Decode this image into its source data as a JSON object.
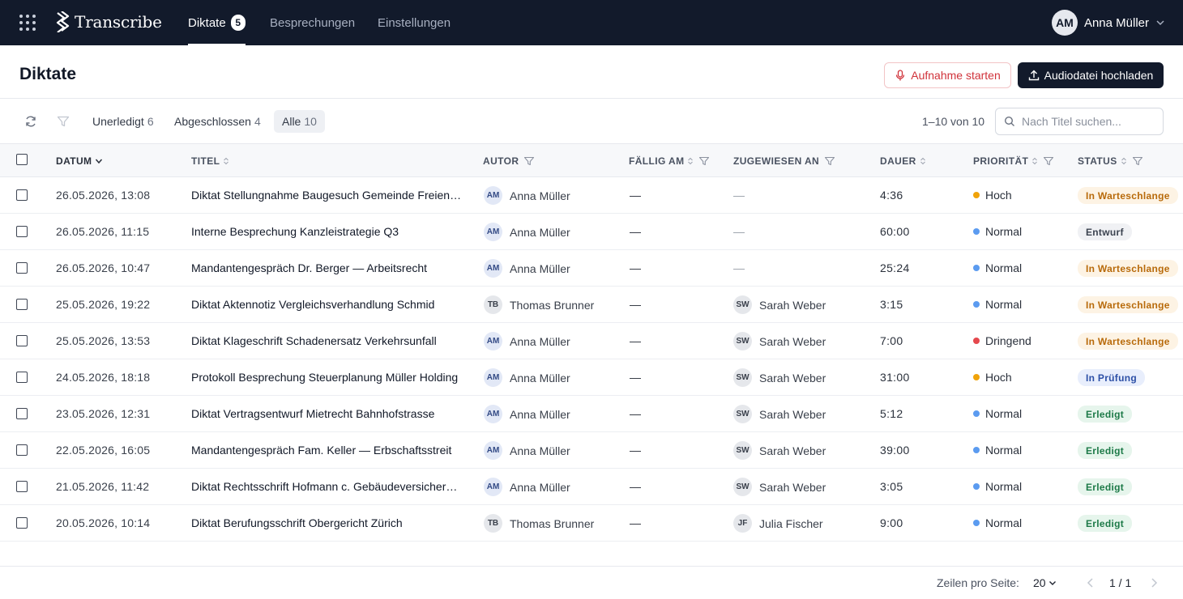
{
  "nav": {
    "brand": "Transcribe",
    "items": [
      {
        "label": "Diktate",
        "badge": "5"
      },
      {
        "label": "Besprechungen"
      },
      {
        "label": "Einstellungen"
      }
    ],
    "user": {
      "initials": "AM",
      "name": "Anna Müller"
    }
  },
  "header": {
    "title": "Diktate",
    "record_label": "Aufnahme starten",
    "upload_label": "Audiodatei hochladen"
  },
  "toolbar": {
    "tabs": [
      {
        "label": "Unerledigt",
        "count": "6"
      },
      {
        "label": "Abgeschlossen",
        "count": "4"
      },
      {
        "label": "Alle",
        "count": "10"
      }
    ],
    "range": "1–10 von 10",
    "search_placeholder": "Nach Titel suchen..."
  },
  "table": {
    "columns": [
      "DATUM",
      "TITEL",
      "AUTOR",
      "FÄLLIG AM",
      "ZUGEWIESEN AN",
      "DAUER",
      "PRIORITÄT",
      "STATUS"
    ],
    "rows": [
      {
        "date": "26.05.2026, 13:08",
        "title": "Diktat Stellungnahme Baugesuch Gemeinde Freienbach",
        "author_initials": "AM",
        "author": "Anna Müller",
        "due": "—",
        "assignee_initials": "",
        "assignee": "—",
        "duration": "4:36",
        "priority": "Hoch",
        "status": "In Warteschlange"
      },
      {
        "date": "26.05.2026, 11:15",
        "title": "Interne Besprechung Kanzleistrategie Q3",
        "author_initials": "AM",
        "author": "Anna Müller",
        "due": "—",
        "assignee_initials": "",
        "assignee": "—",
        "duration": "60:00",
        "priority": "Normal",
        "status": "Entwurf"
      },
      {
        "date": "26.05.2026, 10:47",
        "title": "Mandantengespräch Dr. Berger — Arbeitsrecht",
        "author_initials": "AM",
        "author": "Anna Müller",
        "due": "—",
        "assignee_initials": "",
        "assignee": "—",
        "duration": "25:24",
        "priority": "Normal",
        "status": "In Warteschlange"
      },
      {
        "date": "25.05.2026, 19:22",
        "title": "Diktat Aktennotiz Vergleichsverhandlung Schmid",
        "author_initials": "TB",
        "author": "Thomas Brunner",
        "due": "—",
        "assignee_initials": "SW",
        "assignee": "Sarah Weber",
        "duration": "3:15",
        "priority": "Normal",
        "status": "In Warteschlange"
      },
      {
        "date": "25.05.2026, 13:53",
        "title": "Diktat Klageschrift Schadenersatz Verkehrsunfall",
        "author_initials": "AM",
        "author": "Anna Müller",
        "due": "—",
        "assignee_initials": "SW",
        "assignee": "Sarah Weber",
        "duration": "7:00",
        "priority": "Dringend",
        "status": "In Warteschlange"
      },
      {
        "date": "24.05.2026, 18:18",
        "title": "Protokoll Besprechung Steuerplanung Müller Holding",
        "author_initials": "AM",
        "author": "Anna Müller",
        "due": "—",
        "assignee_initials": "SW",
        "assignee": "Sarah Weber",
        "duration": "31:00",
        "priority": "Hoch",
        "status": "In Prüfung"
      },
      {
        "date": "23.05.2026, 12:31",
        "title": "Diktat Vertragsentwurf Mietrecht Bahnhofstrasse",
        "author_initials": "AM",
        "author": "Anna Müller",
        "due": "—",
        "assignee_initials": "SW",
        "assignee": "Sarah Weber",
        "duration": "5:12",
        "priority": "Normal",
        "status": "Erledigt"
      },
      {
        "date": "22.05.2026, 16:05",
        "title": "Mandantengespräch Fam. Keller — Erbschaftsstreit",
        "author_initials": "AM",
        "author": "Anna Müller",
        "due": "—",
        "assignee_initials": "SW",
        "assignee": "Sarah Weber",
        "duration": "39:00",
        "priority": "Normal",
        "status": "Erledigt"
      },
      {
        "date": "21.05.2026, 11:42",
        "title": "Diktat Rechtsschrift Hofmann c. Gebäudeversicherung",
        "author_initials": "AM",
        "author": "Anna Müller",
        "due": "—",
        "assignee_initials": "SW",
        "assignee": "Sarah Weber",
        "duration": "3:05",
        "priority": "Normal",
        "status": "Erledigt"
      },
      {
        "date": "20.05.2026, 10:14",
        "title": "Diktat Berufungsschrift Obergericht Zürich",
        "author_initials": "TB",
        "author": "Thomas Brunner",
        "due": "—",
        "assignee_initials": "JF",
        "assignee": "Julia Fischer",
        "duration": "9:00",
        "priority": "Normal",
        "status": "Erledigt"
      }
    ]
  },
  "priority_colors": {
    "Hoch": "#f0a30a",
    "Normal": "#5b9bf0",
    "Dringend": "#e5484d"
  },
  "status_styles": {
    "In Warteschlange": {
      "bg": "#fdf3e4",
      "fg": "#b86a0a"
    },
    "Entwurf": {
      "bg": "#f0f1f4",
      "fg": "#3c4350"
    },
    "In Prüfung": {
      "bg": "#e8eefc",
      "fg": "#2c4fa6"
    },
    "Erledigt": {
      "bg": "#e6f5ec",
      "fg": "#1d7a48"
    }
  },
  "footer": {
    "rows_label": "Zeilen pro Seite:",
    "rows_value": "20",
    "page": "1 / 1"
  }
}
